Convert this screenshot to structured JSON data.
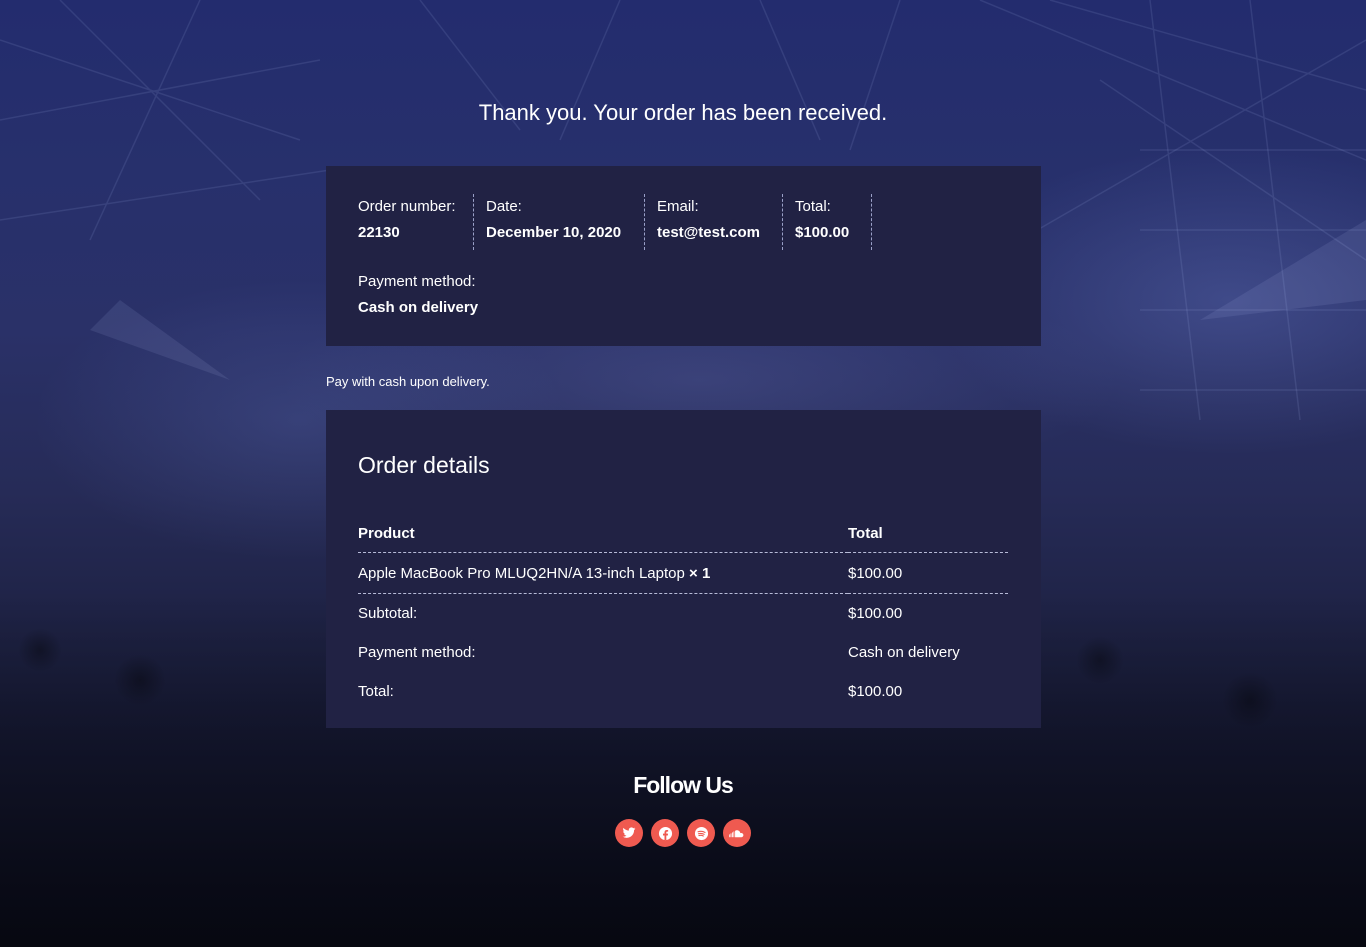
{
  "heading": "Thank you. Your order has been received.",
  "overview": {
    "order_number_label": "Order number:",
    "order_number": "22130",
    "date_label": "Date:",
    "date": "December 10, 2020",
    "email_label": "Email:",
    "email": "test@test.com",
    "total_label": "Total:",
    "total": "$100.00",
    "payment_label": "Payment method:",
    "payment": "Cash on delivery"
  },
  "payment_note": "Pay with cash upon delivery.",
  "details": {
    "title": "Order details",
    "col_product": "Product",
    "col_total": "Total",
    "items": [
      {
        "name": "Apple MacBook Pro MLUQ2HN/A 13-inch Laptop",
        "qty": "× 1",
        "total": "$100.00"
      }
    ],
    "totals": [
      {
        "label": "Subtotal:",
        "value": "$100.00"
      },
      {
        "label": "Payment method:",
        "value": "Cash on delivery"
      },
      {
        "label": "Total:",
        "value": "$100.00"
      }
    ]
  },
  "footer": {
    "follow_title": "Follow Us",
    "social": [
      "twitter-icon",
      "facebook-icon",
      "spotify-icon",
      "soundcloud-icon"
    ],
    "accent_color": "#ef5a50"
  },
  "colors": {
    "panel": "#212244",
    "background_top": "#232c6e",
    "background_bottom": "#0c0e1e"
  }
}
